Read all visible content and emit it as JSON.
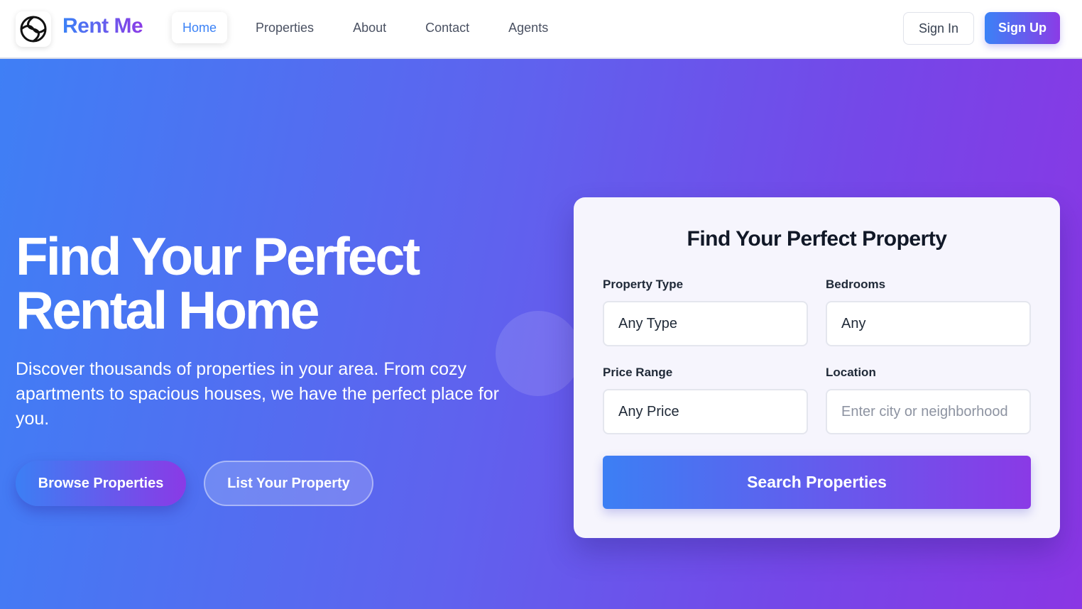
{
  "header": {
    "brand": "Rent Me",
    "nav": [
      "Home",
      "Properties",
      "About",
      "Contact",
      "Agents"
    ],
    "active_nav": "Home",
    "sign_in": "Sign In",
    "sign_up": "Sign Up"
  },
  "hero": {
    "title_line1": "Find Your Perfect",
    "title_line2": "Rental Home",
    "description": "Discover thousands of properties in your area. From cozy apartments to spacious houses, we have the perfect place for you.",
    "browse_button": "Browse Properties",
    "list_button": "List Your Property"
  },
  "search": {
    "title": "Find Your Perfect Property",
    "property_type": {
      "label": "Property Type",
      "value": "Any Type"
    },
    "bedrooms": {
      "label": "Bedrooms",
      "value": "Any"
    },
    "price_range": {
      "label": "Price Range",
      "value": "Any Price"
    },
    "location": {
      "label": "Location",
      "placeholder": "Enter city or neighborhood"
    },
    "submit": "Search Properties"
  },
  "colors": {
    "accent_blue": "#3b82f6",
    "accent_purple": "#8b3ce6",
    "hero_start": "#3f7ff5",
    "hero_end": "#8a36e4"
  }
}
